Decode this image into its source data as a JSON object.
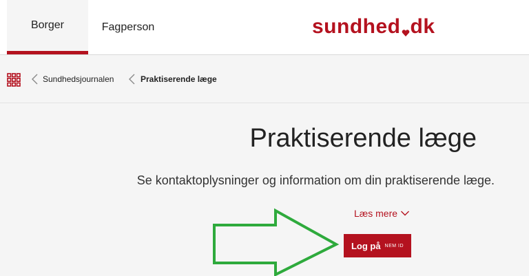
{
  "header": {
    "tabs": [
      {
        "label": "Borger",
        "active": true
      },
      {
        "label": "Fagperson",
        "active": false
      }
    ],
    "logo": {
      "part1": "sundhed",
      "part2": "dk"
    }
  },
  "breadcrumb": {
    "items": [
      {
        "label": "Sundhedsjournalen"
      },
      {
        "label": "Praktiserende læge"
      }
    ]
  },
  "main": {
    "title": "Praktiserende læge",
    "subtitle": "Se kontaktoplysninger og information om din praktiserende læge.",
    "read_more": "Læs mere",
    "login": {
      "label": "Log på",
      "badge": "NEM ID"
    }
  },
  "colors": {
    "brand": "#b4121f",
    "annotation_arrow": "#2eaa3c"
  }
}
